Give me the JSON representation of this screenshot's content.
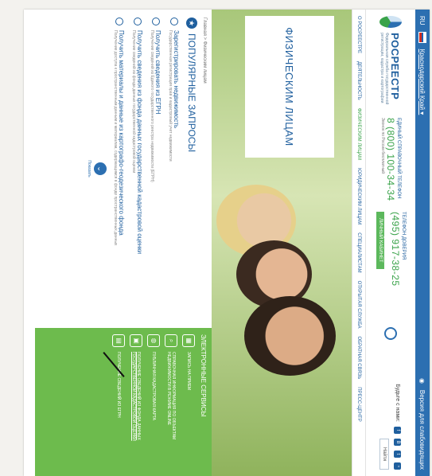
{
  "topbar": {
    "lang": "RU",
    "region": "Краснодарский Край ▾",
    "right_link": "Версия для слабовидящих"
  },
  "header": {
    "logo_name": "РОСРЕЕСТР",
    "logo_sub": "Федеральная служба государственной регистрации, кадастра и картографии",
    "hotline_caption": "Единый справочный телефон",
    "hotline_number": "8 (800) 100-34-34",
    "hotline_note": "Звонок по России бесплатный",
    "trust_caption": "Телефон доверия",
    "trust_number": "(495) 917-38-25",
    "cabinet_label": "ЛИЧНЫЙ КАБИНЕТ",
    "stay_with_us": "Будьте с нами:",
    "find_label": "Найти"
  },
  "nav": {
    "items": [
      "О РОСРЕЕСТРЕ",
      "ДЕЯТЕЛЬНОСТЬ",
      "ФИЗИЧЕСКИМ ЛИЦАМ",
      "ЮРИДИЧЕСКИМ ЛИЦАМ",
      "СПЕЦИАЛИСТАМ",
      "ОТКРЫТАЯ СЛУЖБА",
      "ОБРАТНАЯ СВЯЗЬ",
      "ПРЕСС-ЦЕНТР"
    ]
  },
  "hero": {
    "title": "ФИЗИЧЕСКИМ ЛИЦАМ"
  },
  "breadcrumb": "Главная > Физическим лицам",
  "popular": {
    "title": "ПОПУЛЯРНЫЕ ЗАПРОСЫ",
    "requests": [
      {
        "title": "Зарегистрировать недвижимость",
        "desc": "Государственная регистрация прав и кадастровый учет недвижимости"
      },
      {
        "title": "Получить сведения из ЕГРН",
        "desc": "Получение сведений из Единого государственного реестра недвижимости (ЕГРН)"
      },
      {
        "title": "Получить сведения из фонда данных государственной кадастровой оценки",
        "desc": "Получение сведений из фонда данных государственной кадастровой оценки"
      },
      {
        "title": "Получить материалы и данные из картографо-геодезического фонда",
        "desc": "Получение доступа к пространственным данным и материалам, содержащимся в фонде пространственных данных"
      }
    ],
    "more_label": "Показать"
  },
  "services": {
    "title": "ЭЛЕКТРОННЫЕ СЕРВИСЫ",
    "items": [
      "ЗАПИСЬ НА ПРИЕМ",
      "СПРАВОЧНАЯ ИНФОРМАЦИЯ ПО ОБЪЕКТАМ НЕДВИЖИМОСТИ В РЕЖИМЕ ONLINE",
      "ПУБЛИЧНАЯ КАДАСТРОВАЯ КАРТА",
      "ПОЛУЧЕНИЕ СВЕДЕНИЙ ИЗ ФОНДА ДАННЫХ ГОСУДАРСТВЕННОЙ КАДАСТРОВОЙ ОЦЕНКИ",
      "ПОЛУЧЕНИЕ СВЕДЕНИЙ ИЗ ЕГРН"
    ]
  },
  "colors": {
    "brand_blue": "#1f5f9e",
    "accent_green": "#6dbb4d"
  }
}
